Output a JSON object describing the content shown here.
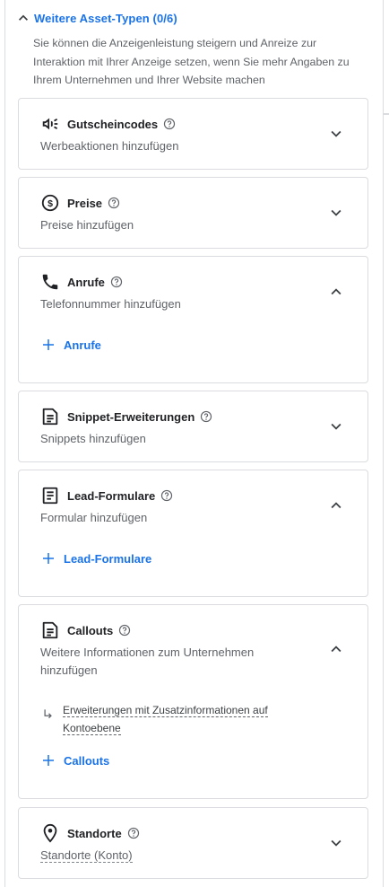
{
  "section": {
    "title": "Weitere Asset-Typen (0/6)",
    "description": "Sie können die Anzeigenleistung steigern und Anreize zur Interaktion mit Ihrer Anzeige setzen, wenn Sie mehr Angaben zu Ihrem Unternehmen und Ihrer Website machen"
  },
  "cards": {
    "coupons": {
      "title": "Gutscheincodes",
      "subtitle": "Werbeaktionen hinzufügen",
      "icon": "megaphone-icon",
      "expanded": false
    },
    "prices": {
      "title": "Preise",
      "subtitle": "Preise hinzufügen",
      "icon": "dollar-circle-icon",
      "expanded": false
    },
    "calls": {
      "title": "Anrufe",
      "subtitle": "Telefonnummer hinzufügen",
      "icon": "phone-icon",
      "expanded": true,
      "add_label": "Anrufe"
    },
    "snippets": {
      "title": "Snippet-Erweiterungen",
      "subtitle": "Snippets hinzufügen",
      "icon": "document-icon",
      "expanded": false
    },
    "lead_forms": {
      "title": "Lead-Formulare",
      "subtitle": "Formular hinzufügen",
      "icon": "form-icon",
      "expanded": true,
      "add_label": "Lead-Formulare"
    },
    "callouts": {
      "title": "Callouts",
      "subtitle": "Weitere Informationen zum Unternehmen hinzufügen",
      "icon": "document-icon",
      "expanded": true,
      "account_link": "Erweiterungen mit Zusatzinformationen auf Kontoebene",
      "add_label": "Callouts"
    },
    "locations": {
      "title": "Standorte",
      "subtitle": "Standorte (Konto)",
      "icon": "location-pin-icon",
      "expanded": false
    }
  },
  "colors": {
    "accent": "#1a73e8",
    "text_primary": "#202124",
    "text_secondary": "#5f6368",
    "border": "#dadce0"
  }
}
